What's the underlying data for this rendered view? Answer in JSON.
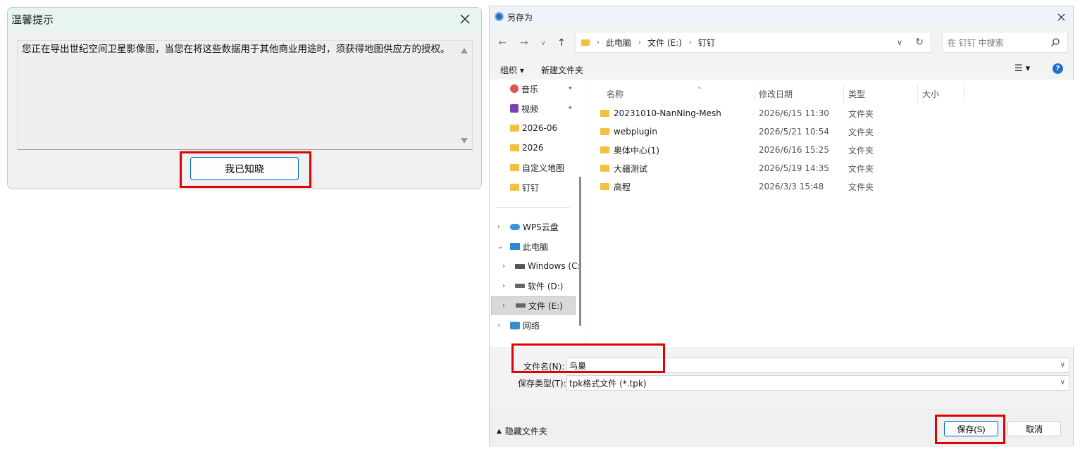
{
  "notice": {
    "title": "温馨提示",
    "message": "您正在导出世纪空间卫星影像图，当您在将这些数据用于其他商业用途时，须获得地图供应方的授权。",
    "ack_button": "我已知晓"
  },
  "saveas": {
    "title": "另存为",
    "address": [
      "此电脑",
      "文件 (E:)",
      "钉钉"
    ],
    "search_placeholder": "在 钉钉 中搜索",
    "toolbar": {
      "organize": "组织",
      "new_folder": "新建文件夹"
    },
    "nav_items": [
      {
        "label": "音乐",
        "icon": "music-icon",
        "pinned": true
      },
      {
        "label": "视频",
        "icon": "video-icon",
        "pinned": true
      },
      {
        "label": "2026-06",
        "icon": "folder-icon"
      },
      {
        "label": "2026",
        "icon": "folder-icon"
      },
      {
        "label": "自定义地图",
        "icon": "folder-icon"
      },
      {
        "label": "钉钉",
        "icon": "folder-icon"
      },
      {
        "label": "WPS云盘",
        "icon": "cloud-icon"
      },
      {
        "label": "此电脑",
        "icon": "computer-icon"
      },
      {
        "label": "Windows (C:",
        "icon": "drive-icon"
      },
      {
        "label": "软件 (D:)",
        "icon": "drive-icon"
      },
      {
        "label": "文件 (E:)",
        "icon": "drive-icon",
        "selected": true
      },
      {
        "label": "网络",
        "icon": "network-icon"
      }
    ],
    "columns": [
      "名称",
      "修改日期",
      "类型",
      "大小"
    ],
    "files": [
      {
        "name": "20231010-NanNing-Mesh",
        "date": "2026/6/15 11:30",
        "type": "文件夹"
      },
      {
        "name": "webplugin",
        "date": "2026/5/21 10:54",
        "type": "文件夹"
      },
      {
        "name": "奥体中心(1)",
        "date": "2026/6/16 15:25",
        "type": "文件夹"
      },
      {
        "name": "大疆测试",
        "date": "2026/5/19 14:35",
        "type": "文件夹"
      },
      {
        "name": "高程",
        "date": "2026/3/3 15:48",
        "type": "文件夹"
      }
    ],
    "filename_label": "文件名(N):",
    "filename_value": "鸟巢",
    "filetype_label": "保存类型(T):",
    "filetype_value": "tpk格式文件 (*.tpk)",
    "hide_folders": "隐藏文件夹",
    "save_button": "保存(S)",
    "cancel_button": "取消"
  },
  "colors": {
    "highlight": "#e00000",
    "accent": "#0067c0",
    "folder": "#f4c042"
  }
}
